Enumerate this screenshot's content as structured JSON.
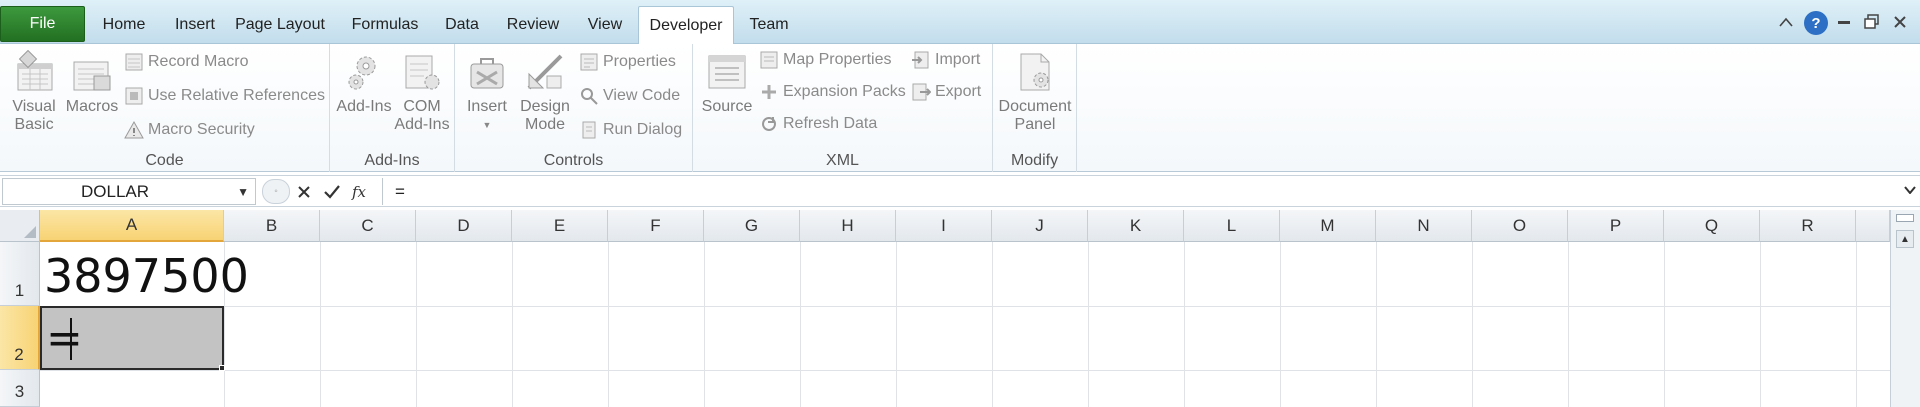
{
  "tabs": {
    "file": "File",
    "items": [
      "Home",
      "Insert",
      "Page Layout",
      "Formulas",
      "Data",
      "Review",
      "View",
      "Developer",
      "Team"
    ],
    "active": "Developer"
  },
  "window_controls": {
    "help": "?"
  },
  "ribbon": {
    "code": {
      "label": "Code",
      "visual_basic": [
        "Visual",
        "Basic"
      ],
      "macros": "Macros",
      "record_macro": "Record Macro",
      "use_relative": "Use Relative References",
      "macro_security": "Macro Security"
    },
    "addins": {
      "label": "Add-Ins",
      "addins": "Add-Ins",
      "com_addins": [
        "COM",
        "Add-Ins"
      ]
    },
    "controls": {
      "label": "Controls",
      "insert": "Insert",
      "design_mode": [
        "Design",
        "Mode"
      ],
      "properties": "Properties",
      "view_code": "View Code",
      "run_dialog": "Run Dialog"
    },
    "xml": {
      "label": "XML",
      "source": "Source",
      "map_properties": "Map Properties",
      "expansion_packs": "Expansion Packs",
      "refresh_data": "Refresh Data",
      "import": "Import",
      "export": "Export"
    },
    "modify": {
      "label": "Modify",
      "document_panel": [
        "Document",
        "Panel"
      ]
    }
  },
  "formula_bar": {
    "name_box": "DOLLAR",
    "formula": "="
  },
  "grid": {
    "columns": [
      "A",
      "B",
      "C",
      "D",
      "E",
      "F",
      "G",
      "H",
      "I",
      "J",
      "K",
      "L",
      "M",
      "N",
      "O",
      "P",
      "Q",
      "R"
    ],
    "rows": [
      "1",
      "2",
      "3"
    ],
    "selected_column": "A",
    "selected_row": "2",
    "cells": {
      "A1": "3897500",
      "A2": "="
    }
  }
}
